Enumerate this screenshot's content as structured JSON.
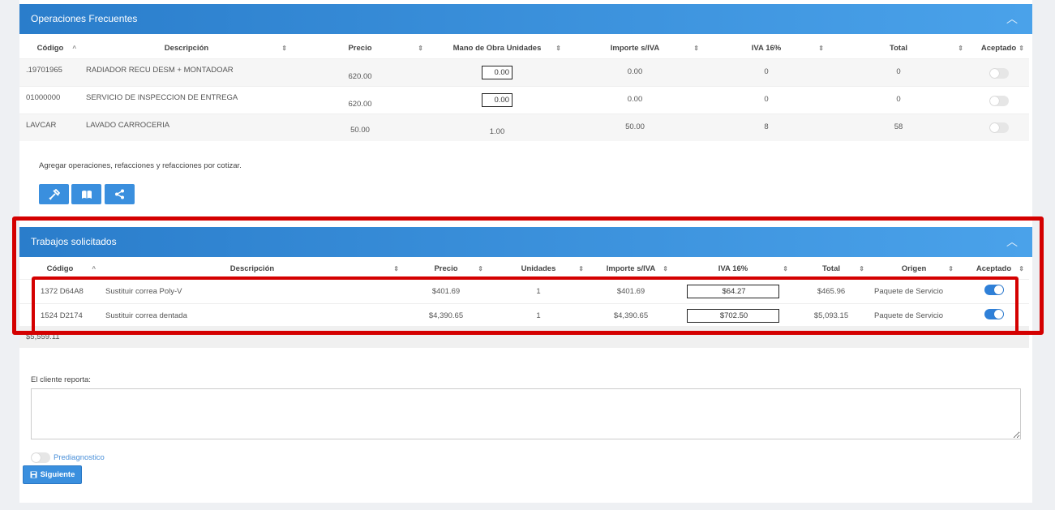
{
  "ops_panel": {
    "title": "Operaciones Frecuentes",
    "columns": [
      "Código",
      "Descripción",
      "Precio",
      "Mano de Obra Unidades",
      "Importe s/IVA",
      "IVA 16%",
      "Total",
      "Aceptado"
    ],
    "rows": [
      {
        "codigo": ".19701965",
        "descripcion": "RADIADOR RECU DESM + MONTADOAR",
        "precio": "620.00",
        "unidades": "0.00",
        "importe": "0.00",
        "iva": "0",
        "total": "0",
        "aceptado": false
      },
      {
        "codigo": "01000000",
        "descripcion": "SERVICIO DE INSPECCION DE ENTREGA",
        "precio": "620.00",
        "unidades": "0.00",
        "importe": "0.00",
        "iva": "0",
        "total": "0",
        "aceptado": false
      },
      {
        "codigo": "LAVCAR",
        "descripcion": "LAVADO CARROCERIA",
        "precio": "50.00",
        "unidades": "1.00",
        "importe": "50.00",
        "iva": "8",
        "total": "58",
        "aceptado": false
      }
    ],
    "add_text": "Agregar operaciones, refacciones y refacciones por cotizar.",
    "buttons": [
      "tools-icon",
      "book-icon",
      "share-icon"
    ]
  },
  "trabajos_panel": {
    "title": "Trabajos solicitados",
    "columns": [
      "Código",
      "Descripción",
      "Precio",
      "Unidades",
      "Importe s/IVA",
      "IVA 16%",
      "Total",
      "Origen",
      "Aceptado"
    ],
    "rows": [
      {
        "codigo": "1372 D64A8",
        "descripcion": "Sustituir correa Poly-V",
        "precio": "$401.69",
        "unidades": "1",
        "importe": "$401.69",
        "iva": "$64.27",
        "total": "$465.96",
        "origen": "Paquete de Servicio",
        "aceptado": true
      },
      {
        "codigo": "1524 D2174",
        "descripcion": "Sustituir correa dentada",
        "precio": "$4,390.65",
        "unidades": "1",
        "importe": "$4,390.65",
        "iva": "$702.50",
        "total": "$5,093.15",
        "origen": "Paquete de Servicio",
        "aceptado": true
      }
    ],
    "grand_total": "$5,559.11"
  },
  "cliente_reporta": {
    "label": "El cliente reporta:",
    "value": ""
  },
  "prediagnostico": {
    "label": "Prediagnostico",
    "on": false
  },
  "next_button": {
    "label": "Siguiente"
  },
  "colors": {
    "header_start": "#2a7dcb",
    "header_end": "#4aa2ea",
    "button": "#3a8fde",
    "highlight": "#d40000",
    "toggle_on": "#2f80d8"
  }
}
